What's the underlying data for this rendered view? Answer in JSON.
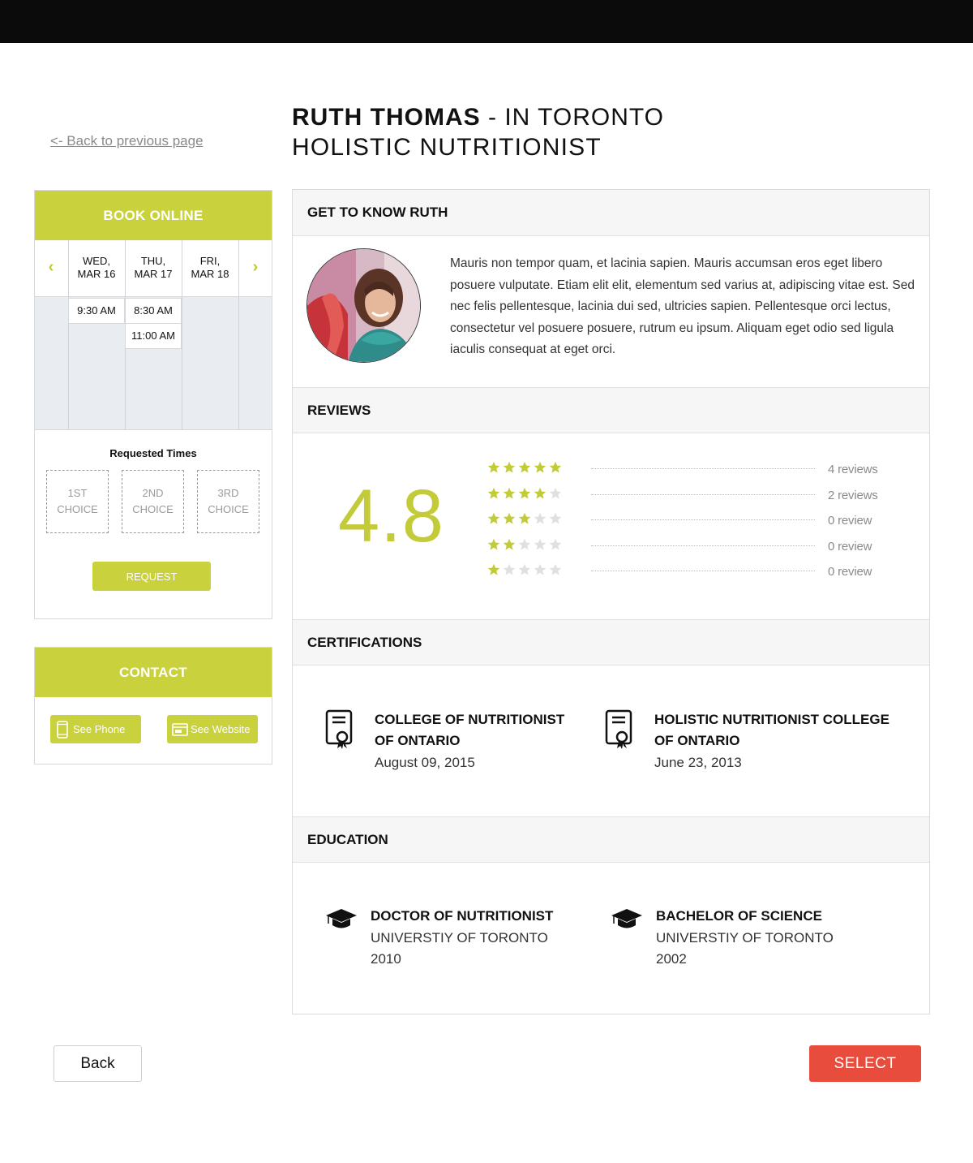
{
  "nav": {
    "back_link": "<- Back to previous page"
  },
  "profile": {
    "name": "RUTH THOMAS",
    "location": " - IN TORONTO",
    "title": "HOLISTIC NUTRITIONIST"
  },
  "booking": {
    "header": "BOOK ONLINE",
    "days": [
      {
        "line1": "WED,",
        "line2": "MAR 16"
      },
      {
        "line1": "THU,",
        "line2": "MAR 17"
      },
      {
        "line1": "FRI,",
        "line2": "MAR 18"
      }
    ],
    "slots": [
      {
        "day_index": 0,
        "time": "9:30 AM"
      },
      {
        "day_index": 1,
        "time": "8:30 AM"
      },
      {
        "day_index": 1,
        "time": "11:00 AM"
      }
    ],
    "requested_title": "Requested Times",
    "choices": [
      {
        "line1": "1ST",
        "line2": "CHOICE"
      },
      {
        "line1": "2ND",
        "line2": "CHOICE"
      },
      {
        "line1": "3RD",
        "line2": "CHOICE"
      }
    ],
    "request_button": "REQUEST",
    "accent": "#c9d13c"
  },
  "contact": {
    "header": "CONTACT",
    "phone_button": "See Phone",
    "website_button": "See Website"
  },
  "about": {
    "header": "GET TO KNOW RUTH",
    "text": "Mauris non tempor quam, et lacinia sapien. Mauris accumsan eros eget libero posuere vulputate. Etiam elit elit, elementum sed varius at, adipiscing vitae est. Sed nec felis pellentesque, lacinia dui sed, ultricies sapien. Pellentesque orci lectus, consectetur vel posuere posuere, rutrum eu ipsum. Aliquam eget odio sed ligula iaculis consequat at eget orci."
  },
  "reviews": {
    "header": "REVIEWS",
    "average": "4.8",
    "rows": [
      {
        "stars": 5,
        "label": "4 reviews"
      },
      {
        "stars": 4,
        "label": "2 reviews"
      },
      {
        "stars": 3,
        "label": "0 review"
      },
      {
        "stars": 2,
        "label": "0 review"
      },
      {
        "stars": 1,
        "label": "0 review"
      }
    ],
    "star_color": "#c3cb38",
    "empty_star_color": "#e0e0e0"
  },
  "certifications": {
    "header": "CERTIFICATIONS",
    "items": [
      {
        "line1": "COLLEGE OF NUTRITIONIST",
        "line2": "OF ONTARIO",
        "date": "August 09, 2015",
        "icon": "certificate-icon"
      },
      {
        "line1": "HOLISTIC NUTRITIONIST COLLEGE",
        "line2": "OF ONTARIO",
        "date": "June 23, 2013",
        "icon": "certificate-icon"
      }
    ]
  },
  "education": {
    "header": "EDUCATION",
    "items": [
      {
        "degree": "DOCTOR OF NUTRITIONIST",
        "school": "UNIVERSTIY OF TORONTO",
        "year": "2010",
        "icon": "graduation-cap-icon"
      },
      {
        "degree": "BACHELOR OF SCIENCE",
        "school": "UNIVERSTIY OF TORONTO",
        "year": "2002",
        "icon": "graduation-cap-icon"
      }
    ]
  },
  "footer": {
    "back_button": "Back",
    "select_button": "SELECT",
    "select_color": "#e74c3c"
  }
}
